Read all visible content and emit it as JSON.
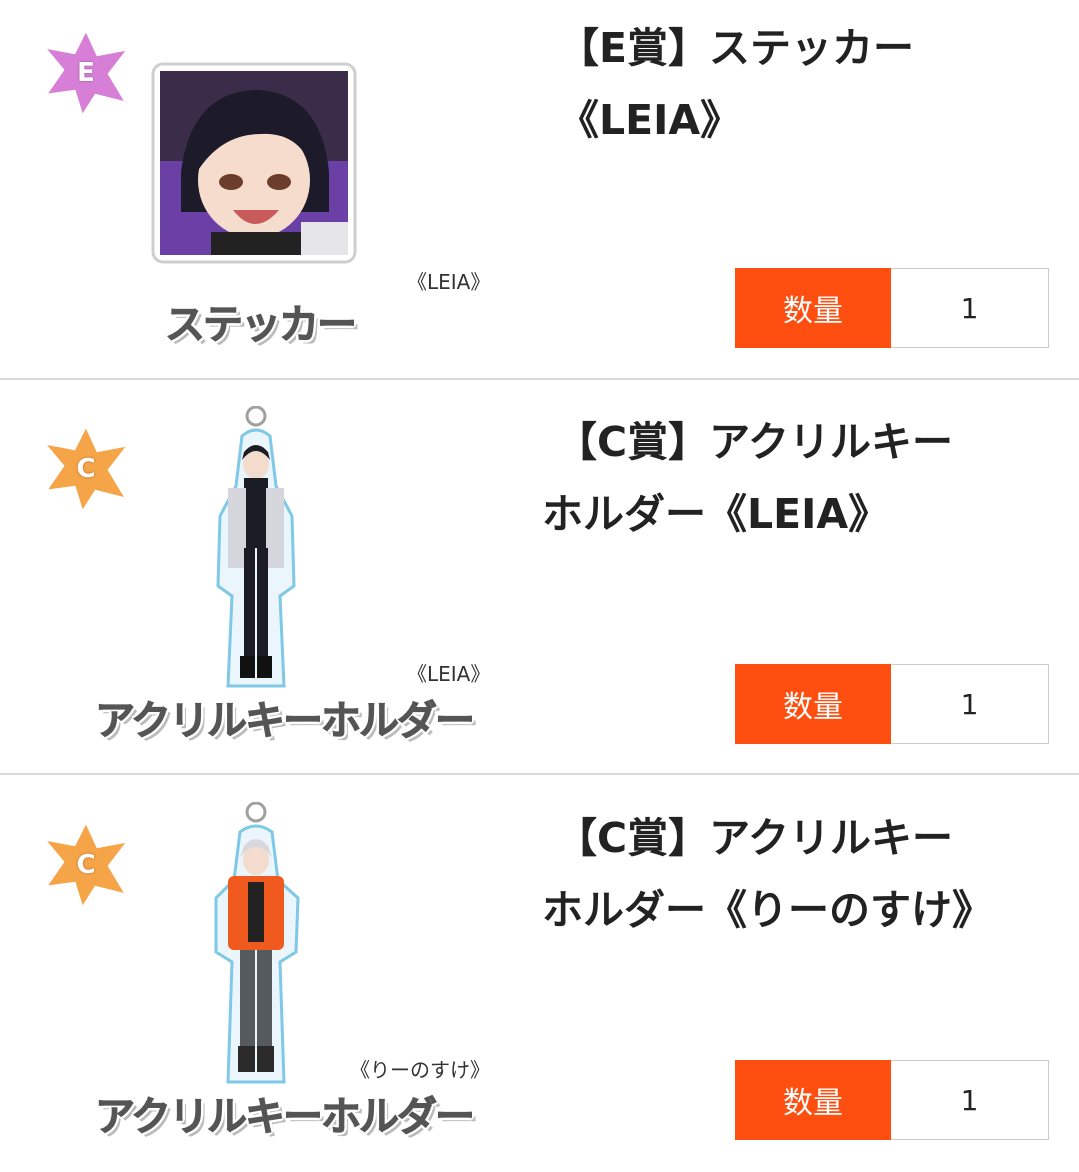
{
  "items": [
    {
      "badge": "E",
      "badge_color": "#d77fd7",
      "variant": "《LEIA》",
      "category": "ステッカー",
      "title_line1": "【E賞】ステッカー",
      "title_line2": "《LEIA》",
      "qty_label": "数量",
      "qty_value": "1"
    },
    {
      "badge": "C",
      "badge_color": "#f5a447",
      "variant": "《LEIA》",
      "category": "アクリルキーホルダー",
      "title_line1": "【C賞】アクリルキー",
      "title_line2": "ホルダー《LEIA》",
      "qty_label": "数量",
      "qty_value": "1"
    },
    {
      "badge": "C",
      "badge_color": "#f5a447",
      "variant": "《りーのすけ》",
      "category": "アクリルキーホルダー",
      "title_line1": "【C賞】アクリルキー",
      "title_line2": "ホルダー《りーのすけ》",
      "qty_label": "数量",
      "qty_value": "1"
    }
  ]
}
